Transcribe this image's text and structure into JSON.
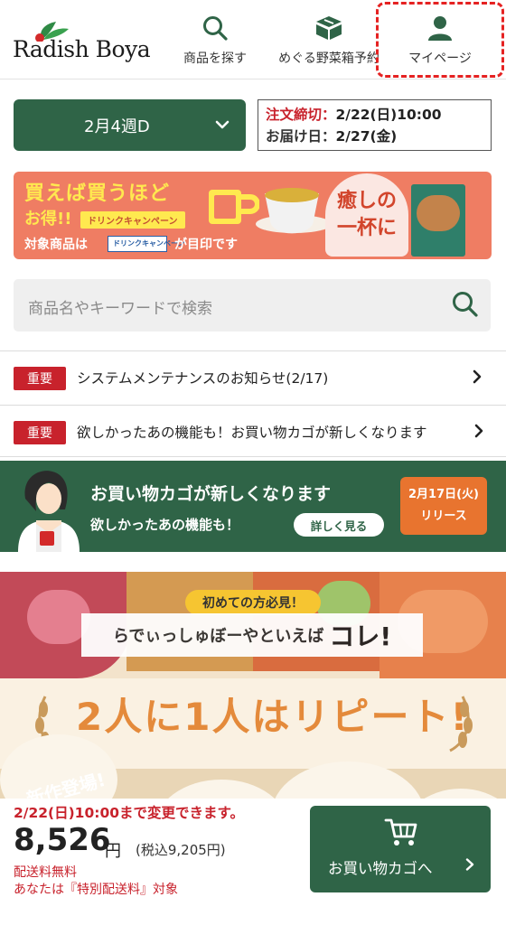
{
  "header": {
    "logo_text": "Radish Boya",
    "nav": {
      "search_label": "商品を探す",
      "box_label": "めぐる野菜箱予約",
      "mypage_label": "マイページ"
    }
  },
  "delivery": {
    "week_label": "2月4週D",
    "deadline_label": "注文締切：",
    "deadline_value": "2/22(日)10:00",
    "arrival_label": "お届け日：",
    "arrival_value": "2/27(金)"
  },
  "drink_banner": {
    "line1": "買えば買うほど",
    "line2": "お得!!",
    "campaign_tag": "ドリンクキャンペーン",
    "line3": "対象商品は",
    "mini_badge": "ドリンクキャンペーン",
    "line4": "が目印です",
    "headline1": "癒しの",
    "headline2": "一杯に"
  },
  "search": {
    "placeholder": "商品名やキーワードで検索"
  },
  "notices": [
    {
      "badge": "重要",
      "text": "システムメンテナンスのお知らせ(2/17)"
    },
    {
      "badge": "重要",
      "text": "欲しかったあの機能も！お買い物カゴが新しくなります"
    }
  ],
  "cart_banner": {
    "title": "お買い物カゴが新しくなります",
    "subtitle": "欲しかったあの機能も！",
    "detail_button": "詳しく見る",
    "release_date": "2月17日(火)",
    "release_label": "リリース"
  },
  "food_banner": {
    "first_tag": "初めての方必見！",
    "strip_small": "らでぃっしゅぼーやといえば",
    "strip_big": "コレ!",
    "repeat_text": "2人に1人はリピート!",
    "new_mark": "新作登場!"
  },
  "order": {
    "change_notice": "2/22(日)10:00まで変更できます。",
    "price": "8,526",
    "yen": "円",
    "tax_included": "(税込9,205円)",
    "shipping_free": "配送料無料",
    "special_shipping": "あなたは『特別配送料』対象",
    "cart_button": "お買い物カゴへ"
  },
  "colors": {
    "brand_green": "#2f6447",
    "alert_red": "#c8222c",
    "highlight_dashed": "#e52222"
  }
}
